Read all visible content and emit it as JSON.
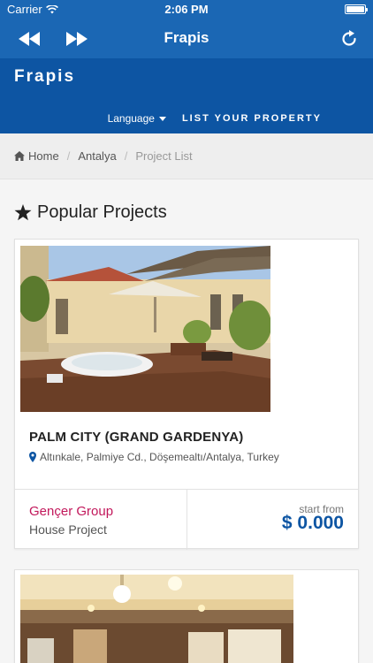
{
  "status_bar": {
    "carrier": "Carrier",
    "time": "2:06 PM"
  },
  "nav": {
    "title": "Frapis",
    "back_icon": "rewind-icon",
    "forward_icon": "fast-forward-icon",
    "refresh_icon": "refresh-icon"
  },
  "header": {
    "brand": "Frapis",
    "language_label": "Language",
    "list_property_label": "LIST YOUR PROPERTY"
  },
  "breadcrumb": {
    "home": "Home",
    "city": "Antalya",
    "current": "Project List"
  },
  "section": {
    "title": "Popular Projects",
    "icon": "star-icon"
  },
  "projects": [
    {
      "title": "PALM CITY (GRAND GARDENYA)",
      "location": "Altınkale, Palmiye Cd., Döşemealtı/Antalya, Turkey",
      "company": "Gençer Group",
      "type": "House Project",
      "price_label": "start from",
      "price": "$ 0.000"
    }
  ],
  "colors": {
    "nav": "#1b67b4",
    "header": "#0d55a3",
    "company": "#c2185b",
    "price": "#0d55a3"
  }
}
